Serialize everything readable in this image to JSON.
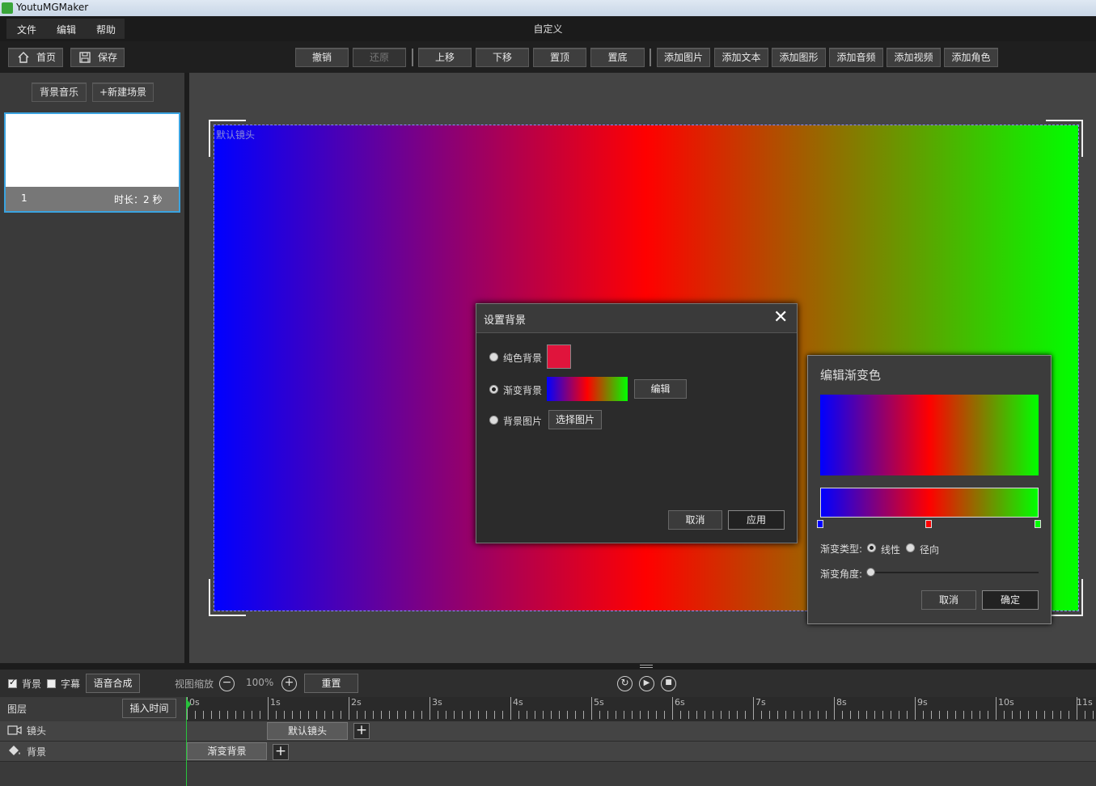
{
  "app": {
    "title": "YoutuMGMaker"
  },
  "menu": {
    "items": [
      "文件",
      "编辑",
      "帮助"
    ],
    "caption": "自定义"
  },
  "toolbar": {
    "home": "首页",
    "save": "保存",
    "undo": "撤销",
    "redo": "还原",
    "move_up": "上移",
    "move_down": "下移",
    "to_top": "置顶",
    "to_bottom": "置底",
    "add_image": "添加图片",
    "add_text": "添加文本",
    "add_shape": "添加图形",
    "add_audio": "添加音频",
    "add_video": "添加视频",
    "add_character": "添加角色"
  },
  "left_panel": {
    "bg_music": "背景音乐",
    "new_scene": "+新建场景",
    "scenes": [
      {
        "index": "1",
        "duration": "时长：2 秒"
      }
    ]
  },
  "stage": {
    "label": "默认镜头",
    "gradient_colors": [
      "#0000ff",
      "#ff0000",
      "#00ff00"
    ]
  },
  "set_bg_dialog": {
    "title": "设置背景",
    "solid_label": "纯色背景",
    "gradient_label": "渐变背景",
    "image_label": "背景图片",
    "selected": "gradient",
    "solid_color": "#e0143c",
    "edit_button": "编辑",
    "choose_image_button": "选择图片",
    "cancel": "取消",
    "apply": "应用"
  },
  "gradient_dialog": {
    "title": "编辑渐变色",
    "type_label": "渐变类型:",
    "type_linear": "线性",
    "type_radial": "径向",
    "type_selected": "linear",
    "angle_label": "渐变角度:",
    "angle_value": 0,
    "stops": [
      {
        "color": "#0000ff",
        "position": 0
      },
      {
        "color": "#ff0000",
        "position": 0.5
      },
      {
        "color": "#00ff00",
        "position": 1
      }
    ],
    "cancel": "取消",
    "ok": "确定"
  },
  "bottom_bar": {
    "bg_checkbox": "背景",
    "bg_checked": true,
    "subtitle_checkbox": "字幕",
    "subtitle_checked": false,
    "tts": "语音合成",
    "zoom_label": "视图缩放",
    "zoom_value": "100%",
    "reset": "重置"
  },
  "timeline": {
    "layers_label": "图层",
    "insert_time": "插入时间",
    "ticks": [
      "0s",
      "1s",
      "2s",
      "3s",
      "4s",
      "5s",
      "6s",
      "7s",
      "8s",
      "9s",
      "10s",
      "11s"
    ],
    "tracks": [
      {
        "name": "镜头",
        "icon": "camera-icon",
        "clip": "默认镜头",
        "clip_start_s": 1
      },
      {
        "name": "背景",
        "icon": "paint-bucket-icon",
        "clip": "渐变背景",
        "clip_start_s": 0
      }
    ]
  }
}
